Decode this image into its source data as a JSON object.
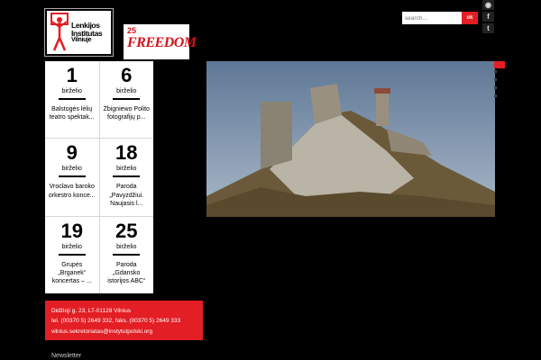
{
  "header": {
    "logo": {
      "line1": "Lenkijos",
      "line2": "Institutas",
      "line3": "Vilniuje"
    },
    "freedom_badge": {
      "number": "25",
      "word": "FREEDOM"
    },
    "search": {
      "placeholder": "search...",
      "button_label": "ok"
    },
    "social_icons": [
      "rss-icon",
      "facebook-icon",
      "twitter-icon"
    ]
  },
  "events": [
    {
      "day": "1",
      "month": "birželio",
      "title": "Balstogės lėlių teatro spektak..."
    },
    {
      "day": "6",
      "month": "birželio",
      "title": "Zbigniewo Polito fotografijų p..."
    },
    {
      "day": "9",
      "month": "birželio",
      "title": "Vroclavo baroko orkestro konce..."
    },
    {
      "day": "18",
      "month": "birželio",
      "title": "Paroda „Pavyzdžiui. Naujasis l..."
    },
    {
      "day": "19",
      "month": "birželio",
      "title": "Grupės „Brganek“ koncertas – ..."
    },
    {
      "day": "25",
      "month": "birželio",
      "title": "Paroda „Gdansko istorijos ABC“"
    }
  ],
  "contact": {
    "address": "Didžioji g. 23, LT-01128 Vilnius",
    "phones": "tel. (00370 5) 2649 332, faks. (00370 5) 2649 333",
    "email": "vilnius.sekretoriatas@instytutpolski.org"
  },
  "footer": {
    "newsletter": "Newsletter"
  },
  "colors": {
    "accent": "#e31e24",
    "background": "#000000",
    "panel": "#ffffff"
  }
}
